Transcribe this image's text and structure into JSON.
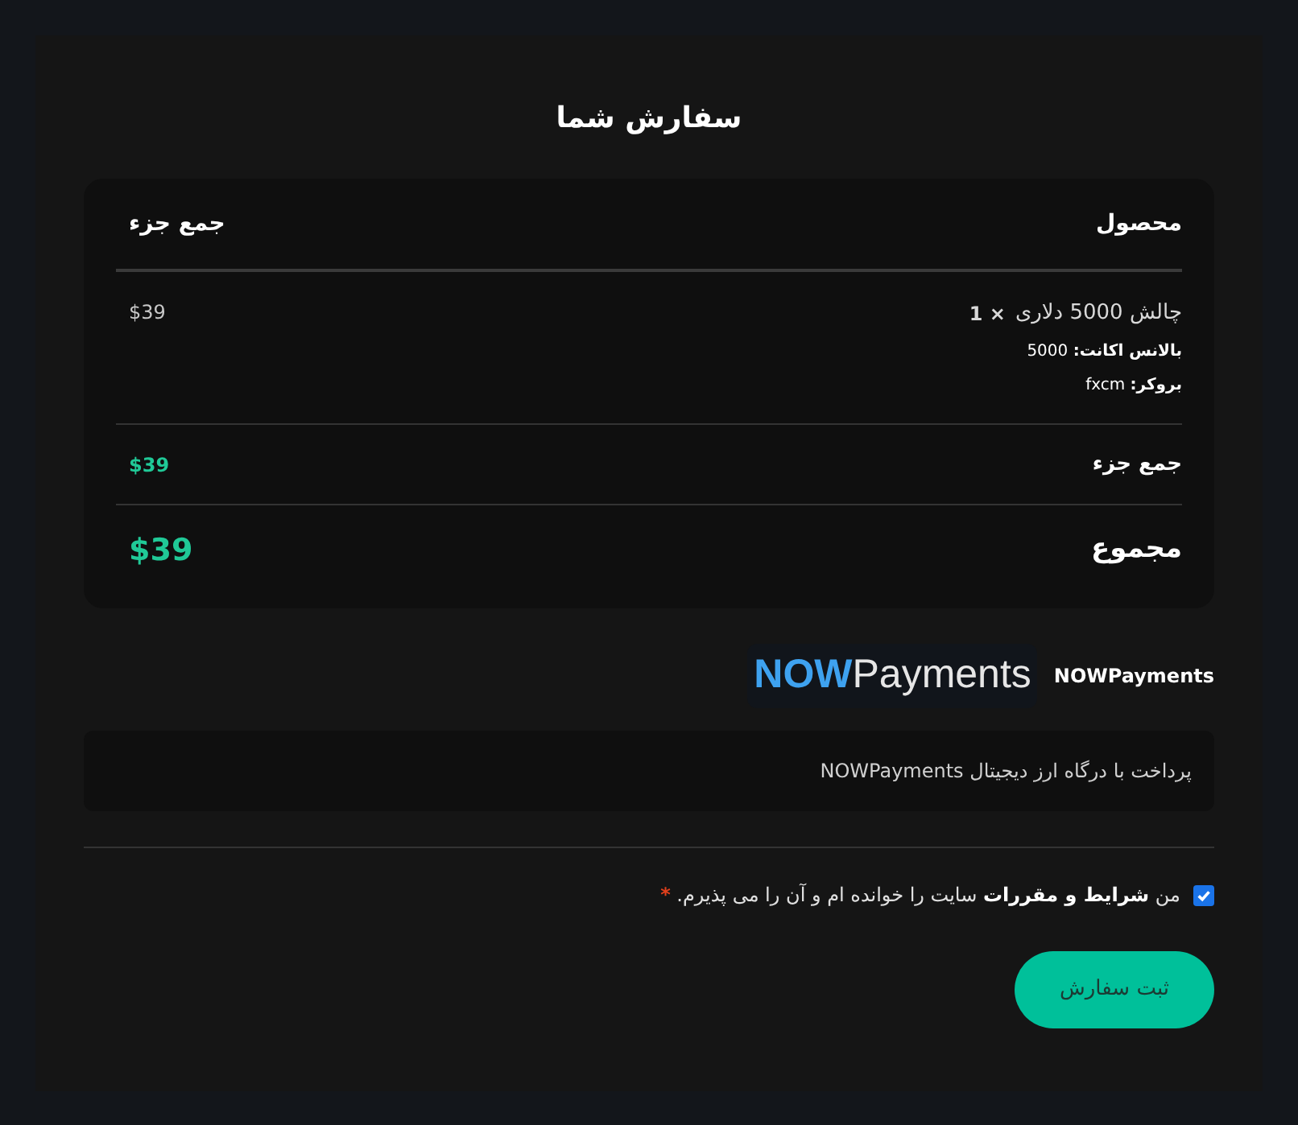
{
  "title": "سفارش شما",
  "table": {
    "columns": [
      "محصول",
      "جمع جزء"
    ],
    "items": [
      {
        "name": "چالش 5000 دلاری",
        "quantity": "× 1",
        "price": "$39",
        "meta": [
          "**بالانس اکانت:** 5000",
          "**بروکر:** fxcm"
        ]
      }
    ],
    "subtotal": {
      "label": "جمع جزء",
      "value": "$39"
    },
    "total": {
      "label": "مجموع",
      "value": "$39"
    }
  },
  "payment": {
    "label": "NOWPayments",
    "logo": {
      "part_1": "NOW",
      "part_2": "Payments"
    },
    "description": "پرداخت با درگاه ارز دیجیتال NOWPayments"
  },
  "terms": {
    "checked": true,
    "prefix": "من",
    "link": "شرایط و مقررات",
    "suffix": "سایت را خوانده ام و آن را می پذیرم.",
    "required_mark": "*"
  },
  "submit_button": "ثبت سفارش"
}
